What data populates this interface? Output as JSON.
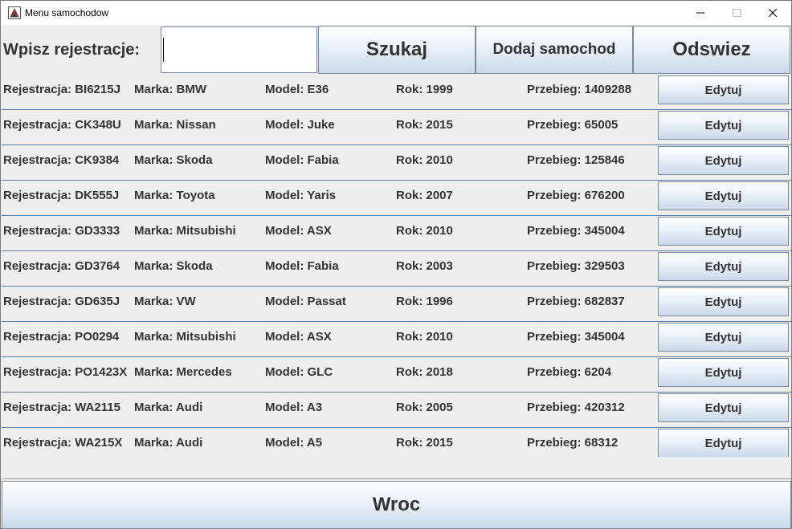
{
  "window": {
    "title": "Menu samochodow",
    "app_icon": "java-app-icon",
    "controls": {
      "minimize": "—",
      "maximize": "☐",
      "close": "✕"
    }
  },
  "search": {
    "label": "Wpisz rejestracje:",
    "value": "",
    "placeholder": ""
  },
  "toolbar": {
    "search_label": "Szukaj",
    "add_label": "Dodaj samochod",
    "refresh_label": "Odswiez"
  },
  "cars": [
    {
      "rejestracja": "Rejestracja: BI6215J",
      "marka": "Marka: BMW",
      "model": "Model: E36",
      "rok": "Rok: 1999",
      "przebieg": "Przebieg: 1409288",
      "edit_label": "Edytuj"
    },
    {
      "rejestracja": "Rejestracja: CK348U",
      "marka": "Marka: Nissan",
      "model": "Model: Juke",
      "rok": "Rok: 2015",
      "przebieg": "Przebieg: 65005",
      "edit_label": "Edytuj"
    },
    {
      "rejestracja": "Rejestracja: CK9384",
      "marka": "Marka: Skoda",
      "model": "Model: Fabia",
      "rok": "Rok: 2010",
      "przebieg": "Przebieg: 125846",
      "edit_label": "Edytuj"
    },
    {
      "rejestracja": "Rejestracja: DK555J",
      "marka": "Marka: Toyota",
      "model": "Model: Yaris",
      "rok": "Rok: 2007",
      "przebieg": "Przebieg: 676200",
      "edit_label": "Edytuj"
    },
    {
      "rejestracja": "Rejestracja: GD3333",
      "marka": "Marka: Mitsubishi",
      "model": "Model: ASX",
      "rok": "Rok: 2010",
      "przebieg": "Przebieg: 345004",
      "edit_label": "Edytuj"
    },
    {
      "rejestracja": "Rejestracja: GD3764",
      "marka": "Marka: Skoda",
      "model": "Model: Fabia",
      "rok": "Rok: 2003",
      "przebieg": "Przebieg: 329503",
      "edit_label": "Edytuj"
    },
    {
      "rejestracja": "Rejestracja: GD635J",
      "marka": "Marka: VW",
      "model": "Model: Passat",
      "rok": "Rok: 1996",
      "przebieg": "Przebieg: 682837",
      "edit_label": "Edytuj"
    },
    {
      "rejestracja": "Rejestracja: PO0294",
      "marka": "Marka: Mitsubishi",
      "model": "Model: ASX",
      "rok": "Rok: 2010",
      "przebieg": "Przebieg: 345004",
      "edit_label": "Edytuj"
    },
    {
      "rejestracja": "Rejestracja: PO1423X",
      "marka": "Marka: Mercedes",
      "model": "Model: GLC",
      "rok": "Rok: 2018",
      "przebieg": "Przebieg: 6204",
      "edit_label": "Edytuj"
    },
    {
      "rejestracja": "Rejestracja: WA2115",
      "marka": "Marka: Audi",
      "model": "Model: A3",
      "rok": "Rok: 2005",
      "przebieg": "Przebieg: 420312",
      "edit_label": "Edytuj"
    },
    {
      "rejestracja": "Rejestracja: WA215X",
      "marka": "Marka: Audi",
      "model": "Model: A5",
      "rok": "Rok: 2015",
      "przebieg": "Przebieg: 68312",
      "edit_label": "Edytuj"
    }
  ],
  "footer": {
    "back_label": "Wroc"
  },
  "colors": {
    "button_gradient_top": "#fdfeff",
    "button_gradient_bottom": "#c9d9ea",
    "row_separator": "#5b7ea6",
    "background": "#eeeeee"
  }
}
